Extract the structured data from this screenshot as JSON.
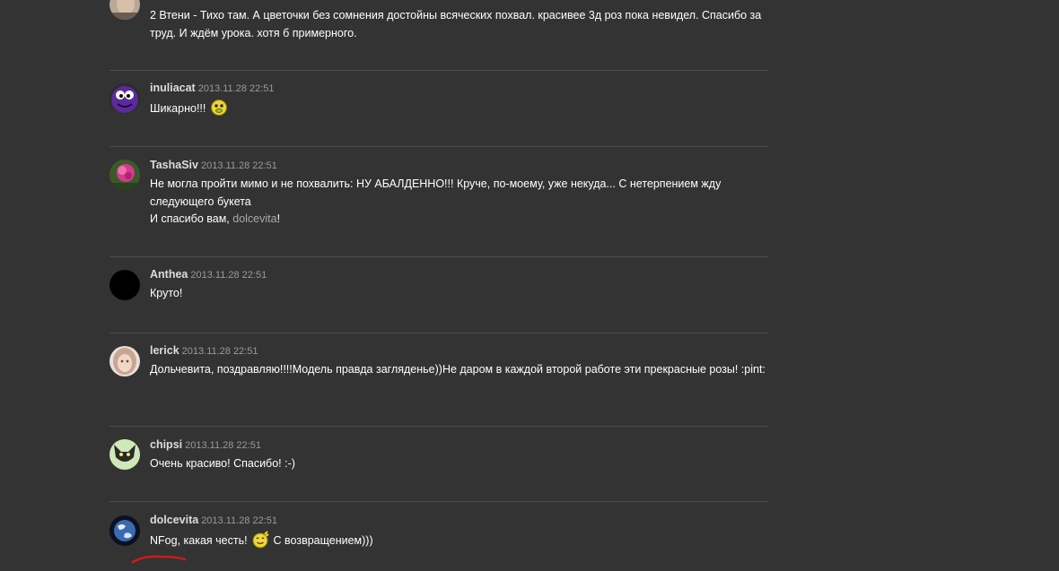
{
  "comments": [
    {
      "author": "",
      "date": "",
      "avatar": "face-avatar",
      "text": "2 Втени - Тихо там. А цветочки без сомнения достойны всяческих похвал. красивее 3д роз пока невидел. Спасибо за труд. И ждём урока. хотя б примерного."
    },
    {
      "author": "inuliacat",
      "date": "2013.11.28 22:51",
      "avatar": "purple-monster-avatar",
      "text": "Шикарно!!!",
      "smiley": "sick-smiley-icon"
    },
    {
      "author": "TashaSiv",
      "date": "2013.11.28 22:51",
      "avatar": "pink-flower-avatar",
      "line1": "Не могла пройти мимо и не похвалить: НУ АБАЛДЕННО!!! Круче, по-моему, уже некуда... С нетерпением жду следующего букета",
      "line2_before": "И спасибо вам, ",
      "mention": "dolcevita",
      "line2_after": "!"
    },
    {
      "author": "Anthea",
      "date": "2013.11.28 22:51",
      "avatar": "black-circle-avatar",
      "text": "Круто!"
    },
    {
      "author": "lerick",
      "date": "2013.11.28 22:51",
      "avatar": "doll-avatar",
      "text": "Дольчевита, поздравляю!!!!Модель правда загляденье))Не даром в каждой второй работе эти прекрасные розы! :pint:"
    },
    {
      "author": "chipsi",
      "date": "2013.11.28 22:51",
      "avatar": "cat-avatar",
      "text": "Очень красиво! Спасибо! :-)"
    },
    {
      "author": "dolcevita",
      "date": "2013.11.28 22:51",
      "avatar": "earth-avatar",
      "text_before": "NFog, какая честь! ",
      "smiley": "wave-smiley-icon",
      "text_after": " С возвращением)))"
    }
  ],
  "colors": {
    "background": "#333333",
    "divider": "#4c4c4c",
    "author": "#dcdcdc",
    "date": "#9a9a9a",
    "text": "#ffffff",
    "mention": "#a8a8a8",
    "annotation": "#cc1a1a"
  }
}
